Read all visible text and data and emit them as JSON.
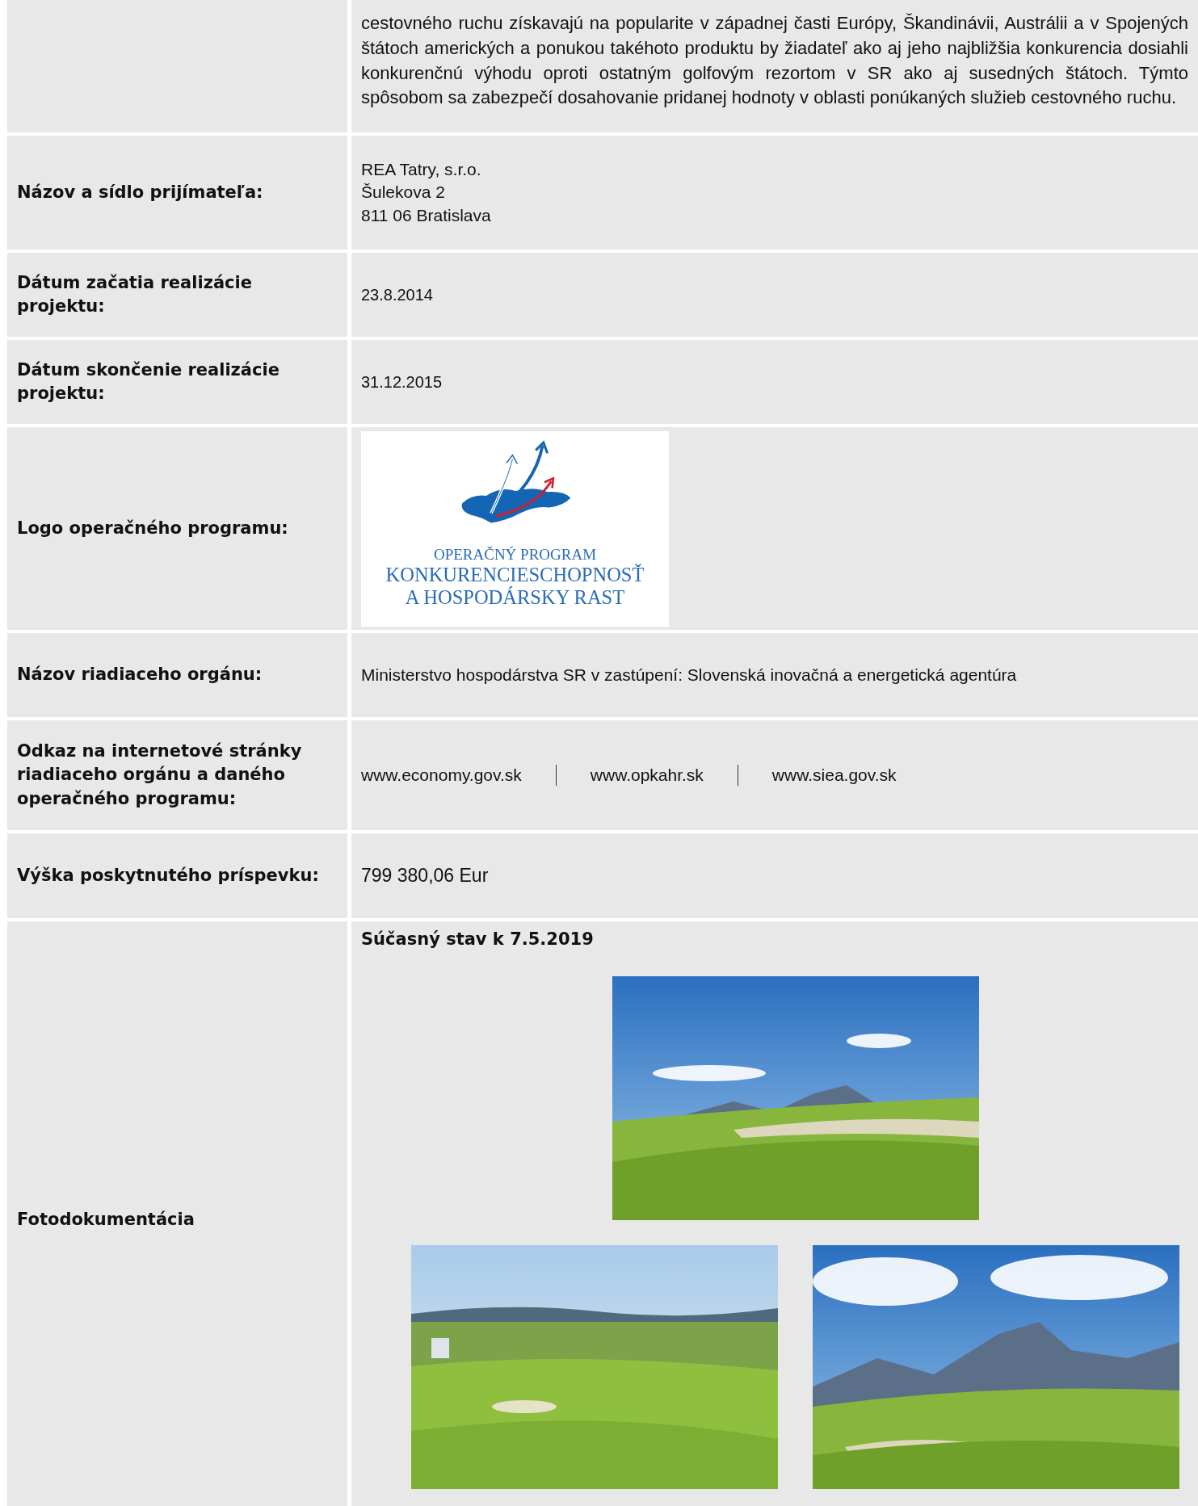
{
  "rows": [
    {
      "kind": "paragraph",
      "text": "cestovného ruchu získavajú na popularite v západnej časti Európy, Škandinávii, Austrálii a v Spojených štátoch amerických a ponukou takéhoto produktu by žiadateľ ako aj jeho najbližšia konkurencia dosiahli konkurenčnú výhodu oproti ostatným golfovým rezortom v SR ako aj susedných štátoch. Týmto spôsobom sa zabezpečí dosahovanie pridanej hodnoty v oblasti ponúkaných služieb cestovného ruchu."
    },
    {
      "kind": "lines",
      "label": "Názov a sídlo prijímateľa:",
      "lines": [
        "REA Tatry, s.r.o.",
        "Šulekova 2",
        "811 06 Bratislava"
      ]
    },
    {
      "kind": "date",
      "label": "Dátum začatia realizácie projektu:",
      "value": "23.8.2014"
    },
    {
      "kind": "date",
      "label": "Dátum skončenie realizácie projektu:",
      "value": "31.12.2015"
    },
    {
      "kind": "logo",
      "label": "Logo operačného programu:",
      "heading": "OPERAČNÝ PROGRAM",
      "title_lines": [
        "KONKURENCIESCHOPNOSŤ",
        "A HOSPODÁRSKY RAST"
      ]
    },
    {
      "kind": "text",
      "label": "Názov riadiaceho orgánu:",
      "value": "Ministerstvo hospodárstva SR v zastúpení: Slovenská inovačná a energetická agentúra"
    },
    {
      "kind": "links",
      "label": "Odkaz na internetové stránky riadiaceho orgánu a daného operačného programu:",
      "links": [
        "www.economy.gov.sk",
        "www.opkahr.sk",
        "www.siea.gov.sk"
      ]
    },
    {
      "kind": "amount",
      "label": "Výška poskytnutého príspevku:",
      "value": "799 380,06 Eur"
    },
    {
      "kind": "gallery",
      "label": "Fotodokumentácia",
      "heading": "Súčasný stav k 7.5.2019"
    }
  ]
}
